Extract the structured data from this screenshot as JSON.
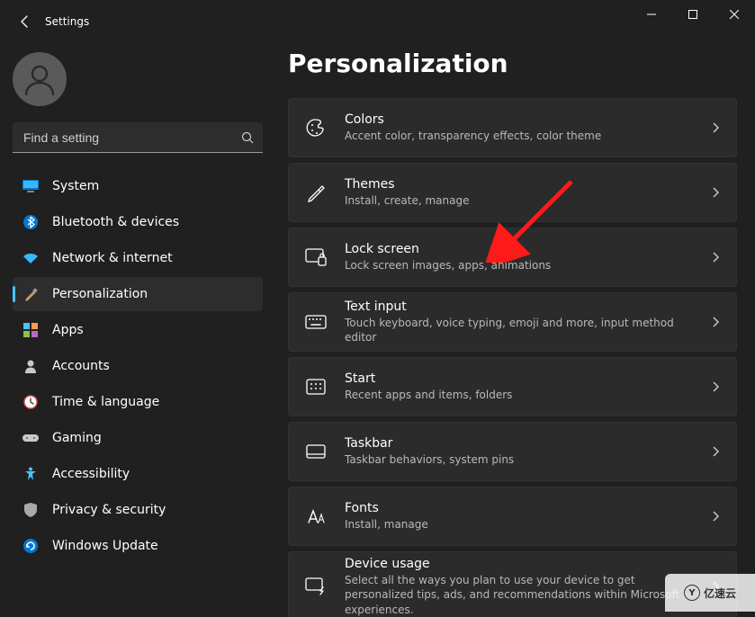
{
  "window": {
    "title": "Settings"
  },
  "search": {
    "placeholder": "Find a setting"
  },
  "sidebar": {
    "items": [
      {
        "label": "System",
        "icon": "monitor-icon"
      },
      {
        "label": "Bluetooth & devices",
        "icon": "bluetooth-icon"
      },
      {
        "label": "Network & internet",
        "icon": "wifi-icon"
      },
      {
        "label": "Personalization",
        "icon": "paint-icon",
        "active": true
      },
      {
        "label": "Apps",
        "icon": "apps-icon"
      },
      {
        "label": "Accounts",
        "icon": "person-icon"
      },
      {
        "label": "Time & language",
        "icon": "clock-icon"
      },
      {
        "label": "Gaming",
        "icon": "gamepad-icon"
      },
      {
        "label": "Accessibility",
        "icon": "accessibility-icon"
      },
      {
        "label": "Privacy & security",
        "icon": "shield-icon"
      },
      {
        "label": "Windows Update",
        "icon": "update-icon"
      }
    ]
  },
  "page": {
    "title": "Personalization",
    "cards": [
      {
        "title": "Colors",
        "sub": "Accent color, transparency effects, color theme",
        "icon": "palette-icon"
      },
      {
        "title": "Themes",
        "sub": "Install, create, manage",
        "icon": "brush-icon"
      },
      {
        "title": "Lock screen",
        "sub": "Lock screen images, apps, animations",
        "icon": "lock-screen-icon"
      },
      {
        "title": "Text input",
        "sub": "Touch keyboard, voice typing, emoji and more, input method editor",
        "icon": "keyboard-icon"
      },
      {
        "title": "Start",
        "sub": "Recent apps and items, folders",
        "icon": "start-icon"
      },
      {
        "title": "Taskbar",
        "sub": "Taskbar behaviors, system pins",
        "icon": "taskbar-icon"
      },
      {
        "title": "Fonts",
        "sub": "Install, manage",
        "icon": "fonts-icon"
      },
      {
        "title": "Device usage",
        "sub": "Select all the ways you plan to use your device to get personalized tips, ads, and recommendations within Microsoft experiences.",
        "icon": "device-usage-icon"
      }
    ]
  },
  "watermark": {
    "text": "亿速云"
  }
}
